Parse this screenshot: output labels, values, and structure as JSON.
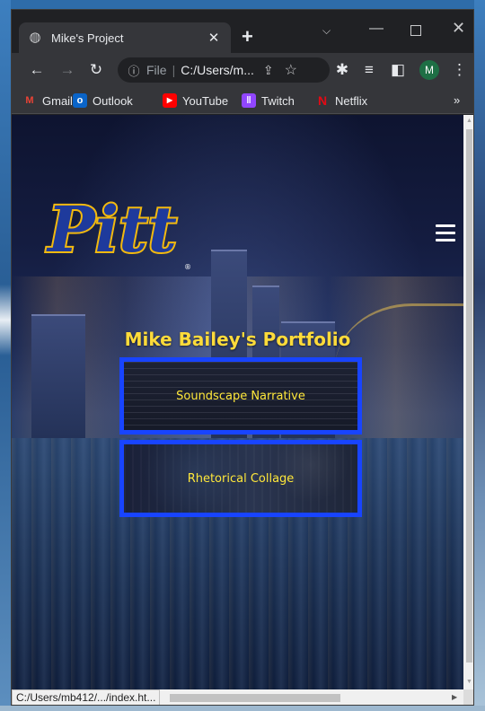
{
  "browser": {
    "tab_title": "Mike's Project",
    "omnibox": {
      "scheme_label": "File",
      "url": "C:/Users/m..."
    },
    "avatar_letter": "M",
    "status_text": "C:/Users/mb412/.../index.ht..."
  },
  "bookmarks": [
    {
      "label": "Gmail"
    },
    {
      "label": "Outlook"
    },
    {
      "label": "YouTube"
    },
    {
      "label": "Twitch"
    },
    {
      "label": "Netflix"
    }
  ],
  "bookmarks_more": "»",
  "page": {
    "title": "Mike Bailey's Portfolio",
    "cards": [
      {
        "label": "Soundscape Narrative"
      },
      {
        "label": "Rhetorical Collage"
      }
    ],
    "logo_text": "Pitt"
  },
  "colors": {
    "title_yellow": "#ffdb3a",
    "card_border": "#1844ff",
    "logo_blue": "#1e3a9c",
    "logo_gold": "#f2b90f"
  }
}
